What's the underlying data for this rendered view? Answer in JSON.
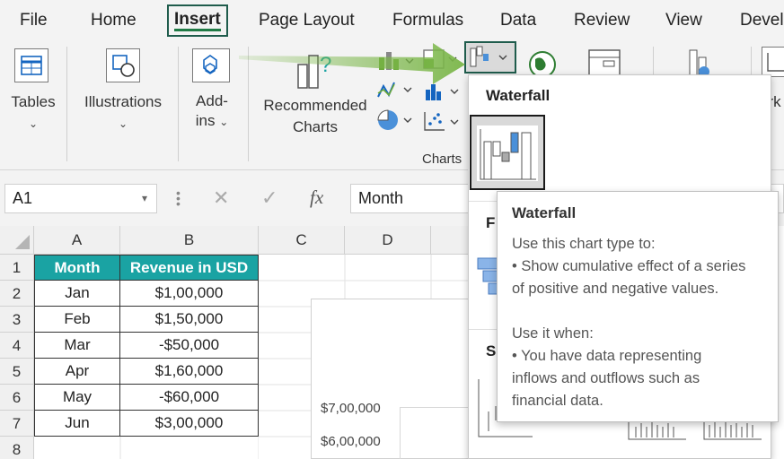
{
  "ribbon_tabs": [
    "File",
    "Home",
    "Insert",
    "Page Layout",
    "Formulas",
    "Data",
    "Review",
    "View",
    "Devel"
  ],
  "active_tab": "Insert",
  "ribbon_groups": {
    "tables": "Tables",
    "illustrations": "Illustrations",
    "addins_line1": "Add-",
    "addins_line2": "ins",
    "recommended_line1": "Recommended",
    "recommended_line2": "Charts",
    "charts_group": "Charts",
    "cut_off": "ark"
  },
  "formula_bar": {
    "name_box": "A1",
    "fx": "fx",
    "value": "Month"
  },
  "columns": [
    "A",
    "B",
    "C",
    "D"
  ],
  "rows": [
    "1",
    "2",
    "3",
    "4",
    "5",
    "6",
    "7",
    "8"
  ],
  "table": {
    "headers": [
      "Month",
      "Revenue in USD"
    ],
    "rows": [
      [
        "Jan",
        "$1,00,000"
      ],
      [
        "Feb",
        "$1,50,000"
      ],
      [
        "Mar",
        "-$50,000"
      ],
      [
        "Apr",
        "$1,60,000"
      ],
      [
        "May",
        "-$60,000"
      ],
      [
        "Jun",
        "$3,00,000"
      ]
    ]
  },
  "chart_axis": [
    "$7,00,000",
    "$6,00,000"
  ],
  "dropdown": {
    "title": "Waterfall",
    "funnel_partial": "F",
    "stock_partial": "S"
  },
  "tooltip": {
    "title": "Waterfall",
    "line1": "Use this chart type to:",
    "line2": "• Show cumulative effect of a series",
    "line3": "of positive and negative values.",
    "line4": "Use it when:",
    "line5": "• You have data representing",
    "line6": "inflows and outflows such as",
    "line7": "financial data."
  },
  "colors": {
    "table_header": "#1aa3a3",
    "active_tab_border": "#1f5c4c",
    "arrow": "#7ab648",
    "chart_blue": "#4a90d9"
  }
}
